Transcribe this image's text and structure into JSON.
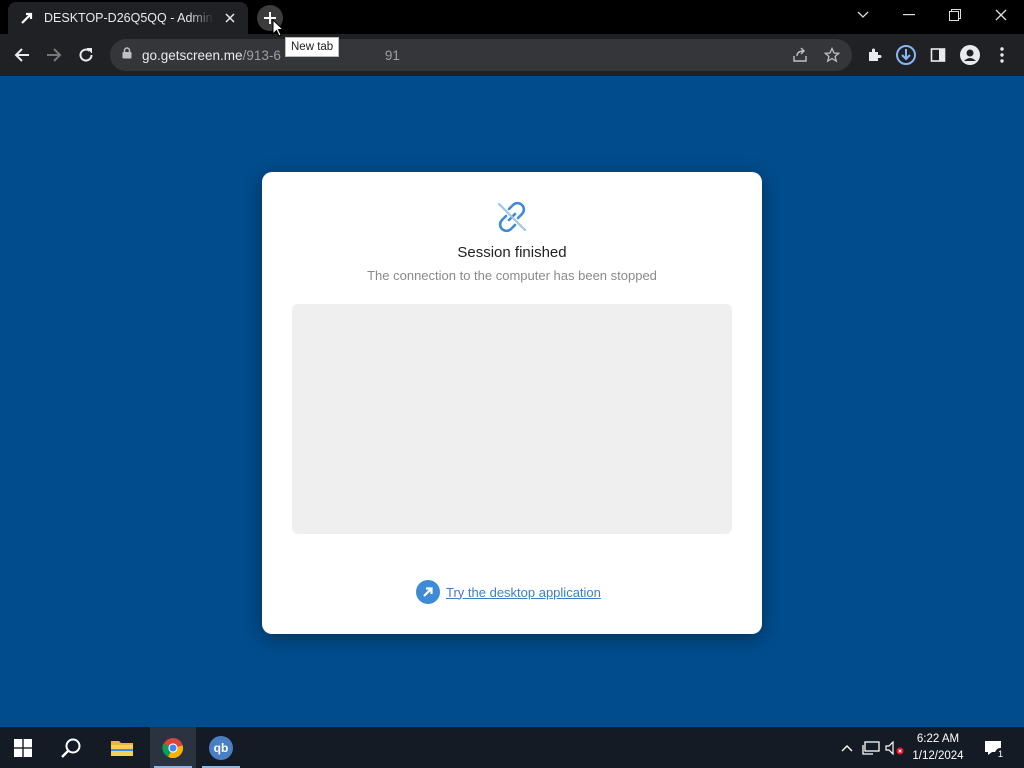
{
  "browser": {
    "tab_title": "DESKTOP-D26Q5QQ - Administ",
    "new_tab_tooltip": "New tab",
    "url_host": "go.getscreen.me",
    "url_path_start": "/913-6",
    "url_path_end": "91"
  },
  "card": {
    "icon": "broken-link-icon",
    "heading": "Session finished",
    "subtext": "The connection to the computer has been stopped",
    "cta_label": "Try the desktop application"
  },
  "taskbar": {
    "apps": [
      "start-icon",
      "search-icon",
      "file-explorer-icon",
      "chrome-icon",
      "qbittorrent-icon"
    ],
    "qb_label": "qb",
    "time": "6:22 AM",
    "date": "1/12/2024",
    "notification_count": "1"
  },
  "colors": {
    "page_background": "#004c8c",
    "accent": "#3d8bd6",
    "link": "#3d7dc4"
  }
}
